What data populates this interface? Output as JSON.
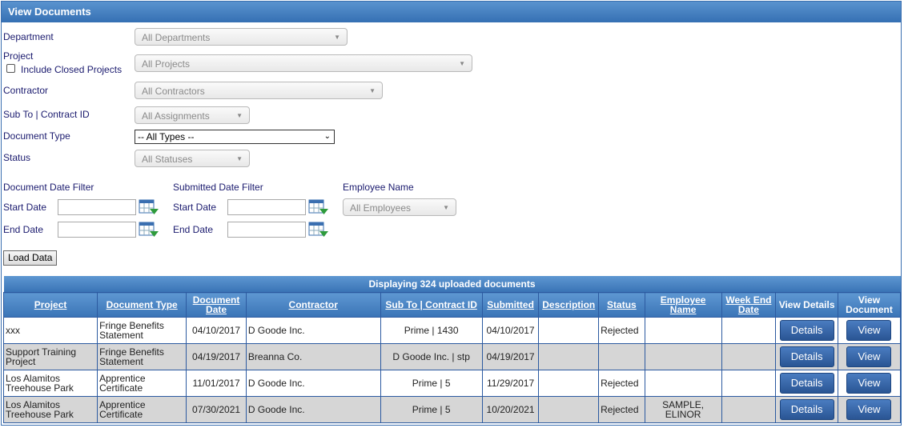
{
  "title": "View Documents",
  "filters": {
    "department_label": "Department",
    "department_value": "All Departments",
    "project_label": "Project",
    "include_closed_label": "Include Closed Projects",
    "project_value": "All Projects",
    "contractor_label": "Contractor",
    "contractor_value": "All Contractors",
    "subto_label": "Sub To | Contract ID",
    "subto_value": "All Assignments",
    "doctype_label": "Document Type",
    "doctype_value": "-- All Types --",
    "status_label": "Status",
    "status_value": "All Statuses",
    "doc_date_filter_label": "Document Date Filter",
    "submitted_date_filter_label": "Submitted Date Filter",
    "employee_name_label": "Employee Name",
    "employee_value": "All Employees",
    "start_date_label": "Start Date",
    "end_date_label": "End Date",
    "load_button": "Load Data"
  },
  "table": {
    "caption": "Displaying 324 uploaded documents",
    "headers": [
      "Project",
      "Document Type",
      "Document Date",
      "Contractor",
      "Sub To | Contract ID",
      "Submitted",
      "Description",
      "Status",
      "Employee Name",
      "Week End Date",
      "View Details",
      "View Document"
    ],
    "details_label": "Details",
    "view_label": "View",
    "rows": [
      {
        "project": "xxx",
        "doc_type": "Fringe Benefits Statement",
        "doc_date": "04/10/2017",
        "contractor": "D Goode Inc.",
        "subto": "Prime | 1430",
        "submitted": "04/10/2017",
        "description": "",
        "status": "Rejected",
        "employee": "",
        "week_end": ""
      },
      {
        "project": "Support Training Project",
        "doc_type": "Fringe Benefits Statement",
        "doc_date": "04/19/2017",
        "contractor": "Breanna Co.",
        "subto": "D Goode Inc. | stp",
        "submitted": "04/19/2017",
        "description": "",
        "status": "",
        "employee": "",
        "week_end": ""
      },
      {
        "project": "Los Alamitos Treehouse Park",
        "doc_type": "Apprentice Certificate",
        "doc_date": "11/01/2017",
        "contractor": "D Goode Inc.",
        "subto": "Prime | 5",
        "submitted": "11/29/2017",
        "description": "",
        "status": "Rejected",
        "employee": "",
        "week_end": ""
      },
      {
        "project": "Los Alamitos Treehouse Park",
        "doc_type": "Apprentice Certificate",
        "doc_date": "07/30/2021",
        "contractor": "D Goode Inc.",
        "subto": "Prime | 5",
        "submitted": "10/20/2021",
        "description": "",
        "status": "Rejected",
        "employee": "SAMPLE, ELINOR",
        "week_end": ""
      }
    ]
  }
}
